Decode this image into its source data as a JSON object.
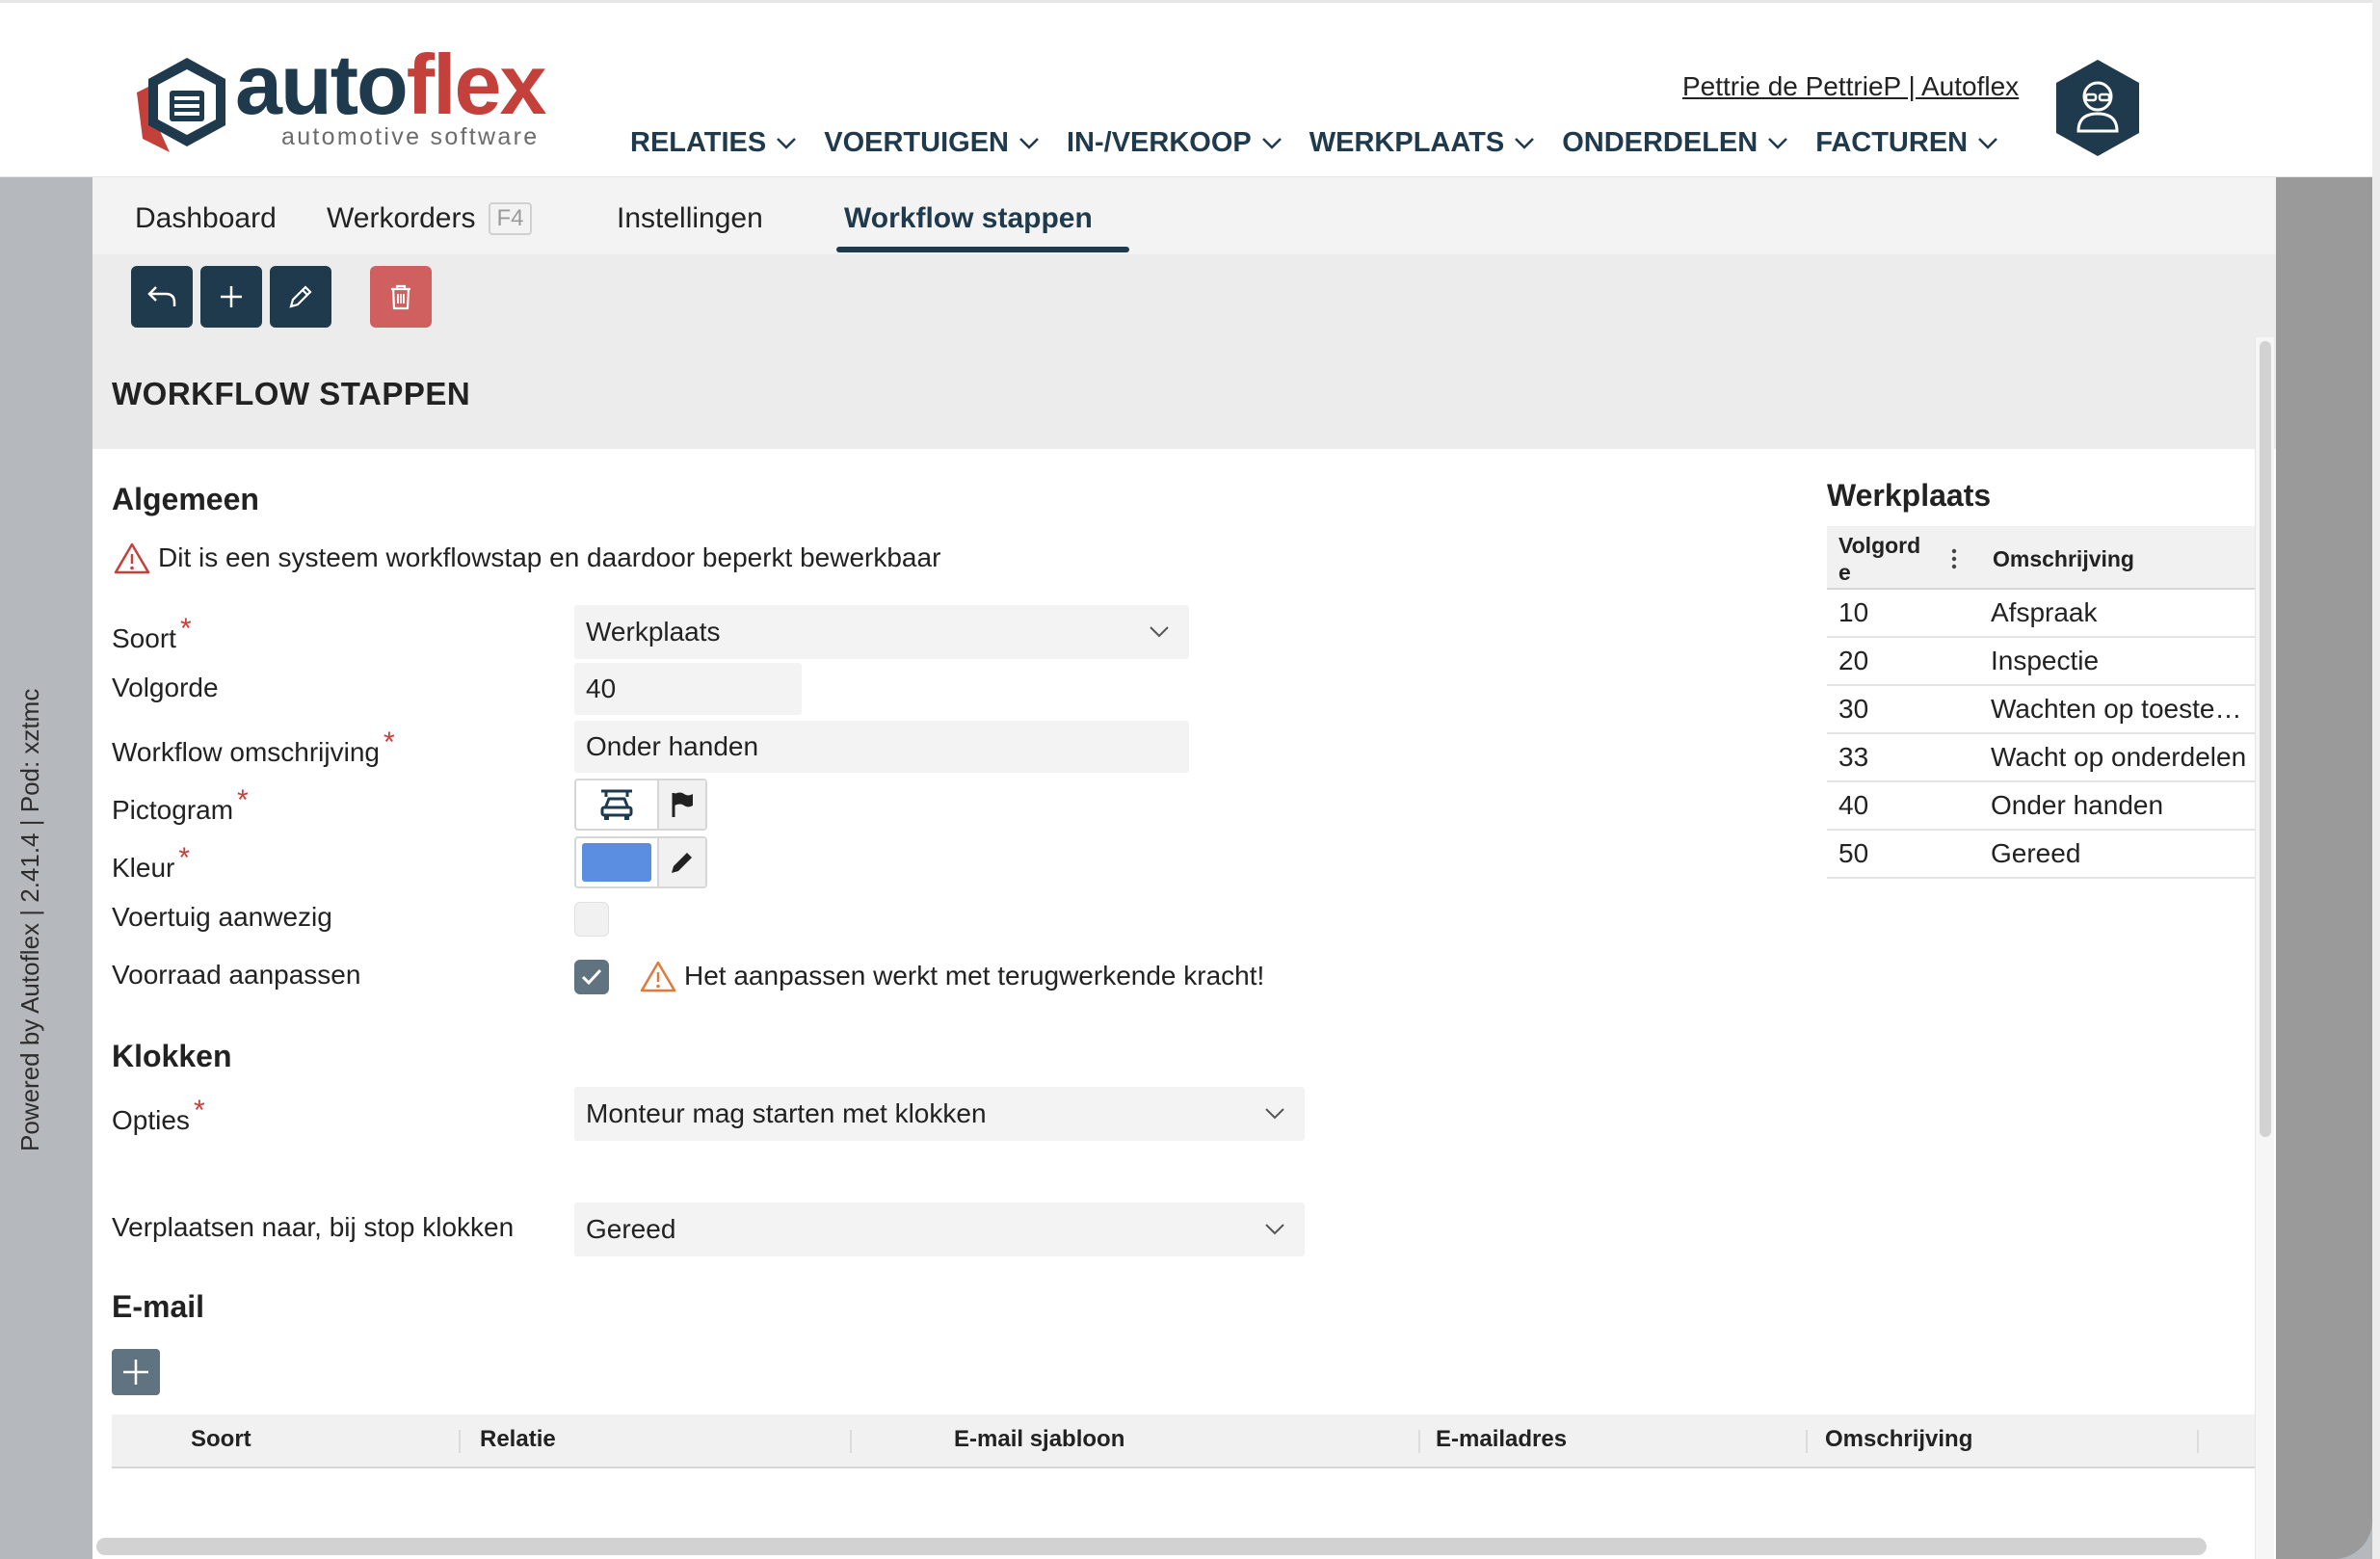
{
  "brand": {
    "name_part1": "auto",
    "name_part2": "flex",
    "tagline": "automotive software",
    "color_primary": "#1e3a4c",
    "color_accent": "#c4403b"
  },
  "nav": {
    "items": [
      {
        "label": "RELATIES"
      },
      {
        "label": "VOERTUIGEN"
      },
      {
        "label": "IN-/VERKOOP"
      },
      {
        "label": "WERKPLAATS"
      },
      {
        "label": "ONDERDELEN"
      },
      {
        "label": "FACTUREN"
      }
    ],
    "user_link": "Pettrie de PettrieP | Autoflex"
  },
  "side": {
    "powered_text": "Powered by Autoflex | 2.41.4 | Pod: xztmc"
  },
  "tabs": {
    "dashboard": "Dashboard",
    "werkorders": "Werkorders",
    "werkorders_shortcut": "F4",
    "instellingen": "Instellingen",
    "workflow": "Workflow stappen"
  },
  "page": {
    "title": "WORKFLOW STAPPEN"
  },
  "form": {
    "section_general": "Algemeen",
    "system_warning": "Dit is een systeem workflowstap en daardoor beperkt bewerkbaar",
    "soort_label": "Soort",
    "soort_value": "Werkplaats",
    "volgorde_label": "Volgorde",
    "volgorde_value": "40",
    "omschrijving_label": "Workflow omschrijving",
    "omschrijving_value": "Onder handen",
    "pictogram_label": "Pictogram",
    "kleur_label": "Kleur",
    "kleur_value": "#5b8ee0",
    "voertuig_label": "Voertuig aanwezig",
    "voertuig_checked": false,
    "voorraad_label": "Voorraad aanpassen",
    "voorraad_checked": true,
    "voorraad_warning": "Het aanpassen werkt met terugwerkende kracht!",
    "section_klokken": "Klokken",
    "opties_label": "Opties",
    "opties_value": "Monteur mag starten met klokken",
    "verplaatsen_label": "Verplaatsen naar, bij stop klokken",
    "verplaatsen_value": "Gereed",
    "section_email": "E-mail",
    "required_mark": "*"
  },
  "email_table": {
    "columns": [
      "Soort",
      "Relatie",
      "E-mail sjabloon",
      "E-mailadres",
      "Omschrijving"
    ]
  },
  "werkplaats": {
    "title": "Werkplaats",
    "col1_line1": "Volgord",
    "col1_line2": "e",
    "col2": "Omschrijving",
    "rows": [
      {
        "volgorde": "10",
        "omschrijving": "Afspraak"
      },
      {
        "volgorde": "20",
        "omschrijving": "Inspectie"
      },
      {
        "volgorde": "30",
        "omschrijving": "Wachten op toestemming"
      },
      {
        "volgorde": "33",
        "omschrijving": "Wacht op onderdelen"
      },
      {
        "volgorde": "40",
        "omschrijving": "Onder handen"
      },
      {
        "volgorde": "50",
        "omschrijving": "Gereed"
      }
    ]
  }
}
